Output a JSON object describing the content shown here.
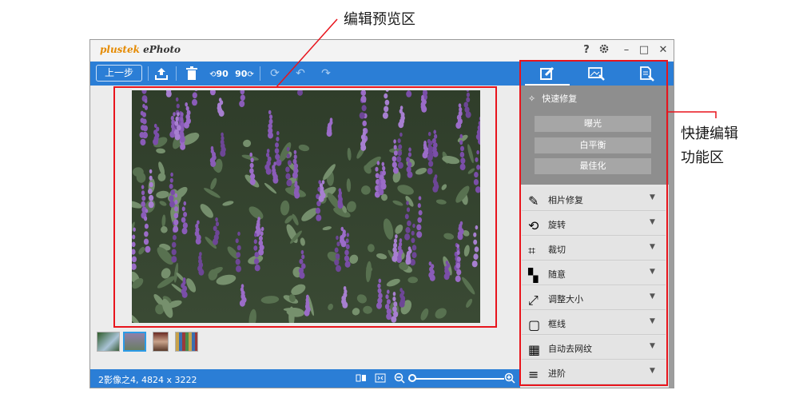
{
  "annotations": {
    "preview_label": "编辑预览区",
    "panel_label_line1": "快捷编辑",
    "panel_label_line2": "功能区"
  },
  "app": {
    "brand": "plustek",
    "product": " ePhoto",
    "window_controls": {
      "help": "?",
      "minimize": "–",
      "maximize": "□",
      "close": "✕"
    }
  },
  "toolbar": {
    "back_label": "上一步",
    "rotate_left_label": "90",
    "rotate_right_label": "90",
    "icons": [
      "upload-icon",
      "trash-icon",
      "rotate-left-90-icon",
      "rotate-right-90-icon",
      "sync-icon",
      "undo-icon",
      "redo-icon"
    ]
  },
  "status": {
    "text": "2影像之4,  4824 x 3222"
  },
  "zoom": {
    "level": 0.0
  },
  "panel": {
    "tabs": [
      "edit-icon",
      "image-adjust-icon",
      "document-edit-icon"
    ],
    "quick": {
      "title": "快速修复",
      "buttons": [
        "曝光",
        "白平衡",
        "最佳化"
      ]
    },
    "sections": [
      {
        "label": "相片修复",
        "icon": "repair-icon"
      },
      {
        "label": "旋转",
        "icon": "rotate-icon"
      },
      {
        "label": "裁切",
        "icon": "crop-icon"
      },
      {
        "label": "随意",
        "icon": "freeform-icon"
      },
      {
        "label": "调整大小",
        "icon": "resize-icon"
      },
      {
        "label": "框线",
        "icon": "border-icon"
      },
      {
        "label": "自动去网纹",
        "icon": "descreen-icon"
      },
      {
        "label": "进阶",
        "icon": "advanced-icon"
      }
    ]
  },
  "thumbnails": {
    "count": 4,
    "selected_index": 1
  },
  "colors": {
    "accent": "#2b7ed6",
    "highlight": "#e8141c",
    "panel_quick_bg": "#8e8e8e"
  }
}
